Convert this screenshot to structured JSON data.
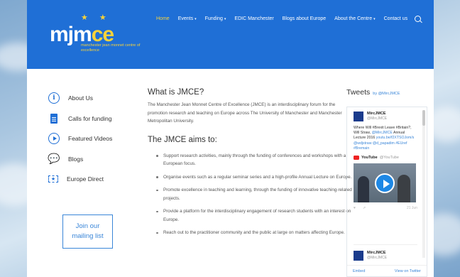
{
  "header": {
    "logo": {
      "word": "mjm",
      "word_accent": "ce",
      "tagline": "manchester jean monnet centre of excellence"
    },
    "nav": [
      {
        "label": "Home",
        "active": true,
        "caret": false
      },
      {
        "label": "Events",
        "active": false,
        "caret": true
      },
      {
        "label": "Funding",
        "active": false,
        "caret": true
      },
      {
        "label": "EDIC Manchester",
        "active": false,
        "caret": false
      },
      {
        "label": "Blogs about Europe",
        "active": false,
        "caret": false
      },
      {
        "label": "About the Centre",
        "active": false,
        "caret": true
      },
      {
        "label": "Contact us",
        "active": false,
        "caret": false
      }
    ]
  },
  "sidebar": {
    "items": [
      {
        "label": "About Us",
        "icon": "info-icon"
      },
      {
        "label": "Calls for funding",
        "icon": "calculator-icon"
      },
      {
        "label": "Featured Videos",
        "icon": "play-icon"
      },
      {
        "label": "Blogs",
        "icon": "chat-icon"
      },
      {
        "label": "Europe Direct",
        "icon": "europe-direct-icon"
      }
    ],
    "join_line1": "Join our",
    "join_line2": "mailing list"
  },
  "main": {
    "title": "What is JMCE?",
    "intro": "The Manchester Jean Monnet Centre of Excellence (JMCE) is an interdisciplinary forum for the promotion research and teaching on Europe across The University of Manchester and Manchester Metropolitan University.",
    "aims_title": "The JMCE aims to:",
    "aims": [
      "Support research activities, mainly through the funding of conferences and workshops with a European focus.",
      "Organise events such as a regular seminar series and a high-profile Annual Lecture on Europe.",
      "Promote excellence in teaching and learning, through the funding of innovative teaching-related projects.",
      "Provide a platform for the interdisciplinary engagement of research students with an interest on Europe.",
      "Reach out to the practitioner community and the public at large on matters affecting Europe."
    ]
  },
  "twitter": {
    "title": "Tweets",
    "by": "by @MircJMCE",
    "tweet1": {
      "name": "MircJMCE",
      "handle": "@MircJMCE",
      "text": "Where Will #Brexit Leave #Britain?, Will Straw, ",
      "text_link1": "@MircJMCE",
      "text2": " Annual Lecture 2016 ",
      "text_link2": "youtu.be/f2XTSOJom/s @wdjstraw @d_papadim #EUref #Bremain",
      "youtube_label": "YouTube",
      "youtube_handle": "@YouTube",
      "time": "21 Jun"
    },
    "tweet2": {
      "name": "MircJMCE",
      "handle": "@MircJMCE"
    },
    "footer_embed": "Embed",
    "footer_view": "View on Twitter"
  }
}
